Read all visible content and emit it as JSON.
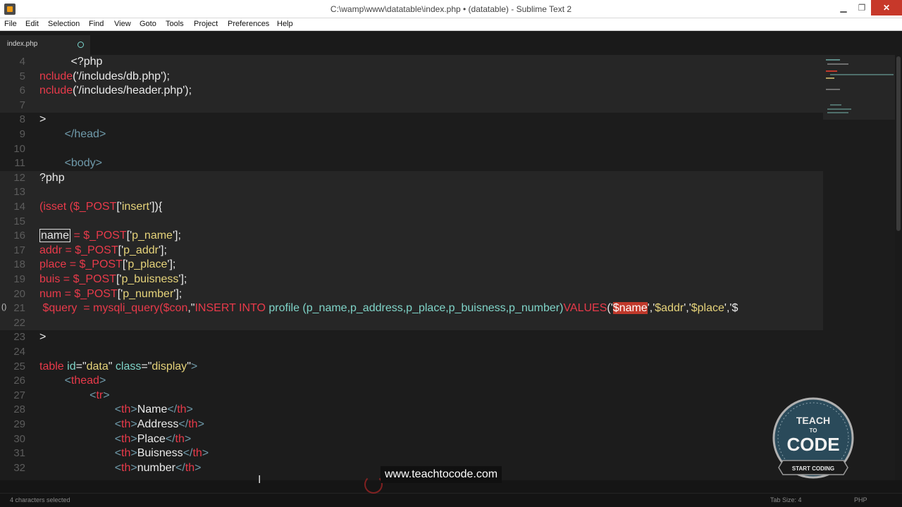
{
  "window": {
    "title": "C:\\wamp\\www\\datatable\\index.php • (datatable) - Sublime Text 2",
    "minimize": "▁",
    "maximize": "❐",
    "close": "✕"
  },
  "menu": [
    "File",
    "Edit",
    "Selection",
    "Find",
    "View",
    "Goto",
    "Tools",
    "Project",
    "Preferences",
    "Help"
  ],
  "tab": {
    "label": "index.php"
  },
  "editor": {
    "lines": [
      {
        "n": "4",
        "hl": true,
        "tokens": [
          [
            "plain",
            "          <?php"
          ]
        ]
      },
      {
        "n": "5",
        "hl": true,
        "tokens": [
          [
            "kw",
            "nclude"
          ],
          [
            "plain",
            "('/includes/db.php');"
          ]
        ]
      },
      {
        "n": "6",
        "hl": true,
        "tokens": [
          [
            "kw",
            "nclude"
          ],
          [
            "plain",
            "('/includes/header.php');"
          ]
        ]
      },
      {
        "n": "7",
        "hl": true,
        "tokens": [
          [
            "plain",
            ""
          ]
        ]
      },
      {
        "n": "8",
        "hl": false,
        "tokens": [
          [
            "plain",
            ">"
          ]
        ]
      },
      {
        "n": "9",
        "hl": false,
        "tokens": [
          [
            "tag",
            "        </"
          ],
          [
            "tag",
            "head"
          ],
          [
            "tag",
            ">"
          ]
        ]
      },
      {
        "n": "10",
        "hl": false,
        "tokens": [
          [
            "plain",
            ""
          ]
        ]
      },
      {
        "n": "11",
        "hl": false,
        "tokens": [
          [
            "tag",
            "        <"
          ],
          [
            "tag",
            "body"
          ],
          [
            "tag",
            ">"
          ]
        ]
      },
      {
        "n": "12",
        "hl": true,
        "tokens": [
          [
            "plain",
            "?php"
          ]
        ]
      },
      {
        "n": "13",
        "hl": true,
        "tokens": [
          [
            "plain",
            ""
          ]
        ]
      },
      {
        "n": "14",
        "hl": true,
        "tokens": [
          [
            "kw",
            "(isset ($_POST"
          ],
          [
            "plain",
            "['"
          ],
          [
            "str",
            "insert"
          ],
          [
            "plain",
            "']){"
          ]
        ]
      },
      {
        "n": "15",
        "hl": true,
        "tokens": [
          [
            "plain",
            ""
          ]
        ]
      },
      {
        "n": "16",
        "hl": true,
        "tokens": [
          [
            "box",
            "name"
          ],
          [
            "kw",
            " = $_POST"
          ],
          [
            "plain",
            "['"
          ],
          [
            "str",
            "p_name"
          ],
          [
            "plain",
            "'];"
          ]
        ]
      },
      {
        "n": "17",
        "hl": true,
        "tokens": [
          [
            "kw",
            "addr = $_POST"
          ],
          [
            "plain",
            "['"
          ],
          [
            "str",
            "p_addr"
          ],
          [
            "plain",
            "'];"
          ]
        ]
      },
      {
        "n": "18",
        "hl": true,
        "tokens": [
          [
            "kw",
            "place = $_POST"
          ],
          [
            "plain",
            "['"
          ],
          [
            "str",
            "p_place"
          ],
          [
            "plain",
            "'];"
          ]
        ]
      },
      {
        "n": "19",
        "hl": true,
        "tokens": [
          [
            "kw",
            "buis = $_POST"
          ],
          [
            "plain",
            "['"
          ],
          [
            "str",
            "p_buisness"
          ],
          [
            "plain",
            "'];"
          ]
        ]
      },
      {
        "n": "20",
        "hl": true,
        "tokens": [
          [
            "kw",
            "num = $_POST"
          ],
          [
            "plain",
            "['"
          ],
          [
            "str",
            "p_number"
          ],
          [
            "plain",
            "'];"
          ]
        ]
      },
      {
        "n": "21",
        "hl": true,
        "tokens": [
          [
            "kw",
            " $query  = mysqli_query("
          ],
          [
            "kw",
            "$con"
          ],
          [
            "plain",
            ",\""
          ],
          [
            "kw",
            "INSERT INTO "
          ],
          [
            "fn",
            "profile (p_name,p_address,p_place,p_buisness,p_number)"
          ],
          [
            "kw",
            "VALUES"
          ],
          [
            "plain",
            "('"
          ],
          [
            "sel",
            "$name"
          ],
          [
            "plain",
            "','"
          ],
          [
            "str",
            "$addr"
          ],
          [
            "plain",
            "','"
          ],
          [
            "str",
            "$place"
          ],
          [
            "plain",
            "','$"
          ]
        ]
      },
      {
        "n": "22",
        "hl": true,
        "tokens": [
          [
            "plain",
            ""
          ]
        ]
      },
      {
        "n": "23",
        "hl": false,
        "tokens": [
          [
            "plain",
            ">"
          ]
        ]
      },
      {
        "n": "24",
        "hl": false,
        "tokens": [
          [
            "plain",
            ""
          ]
        ]
      },
      {
        "n": "25",
        "hl": false,
        "tokens": [
          [
            "kw",
            "table "
          ],
          [
            "att",
            "id"
          ],
          [
            "plain",
            "=\""
          ],
          [
            "str",
            "data"
          ],
          [
            "plain",
            "\" "
          ],
          [
            "att",
            "class"
          ],
          [
            "plain",
            "=\""
          ],
          [
            "str",
            "display"
          ],
          [
            "plain",
            "\""
          ],
          [
            "tag",
            ">"
          ]
        ]
      },
      {
        "n": "26",
        "hl": false,
        "tokens": [
          [
            "tag",
            "        <"
          ],
          [
            "kw",
            "thead"
          ],
          [
            "tag",
            ">"
          ]
        ]
      },
      {
        "n": "27",
        "hl": false,
        "tokens": [
          [
            "tag",
            "                <"
          ],
          [
            "kw",
            "tr"
          ],
          [
            "tag",
            ">"
          ]
        ]
      },
      {
        "n": "28",
        "hl": false,
        "tokens": [
          [
            "tag",
            "                        <"
          ],
          [
            "kw",
            "th"
          ],
          [
            "tag",
            ">"
          ],
          [
            "plain",
            "Name"
          ],
          [
            "tag",
            "</"
          ],
          [
            "kw",
            "th"
          ],
          [
            "tag",
            ">"
          ]
        ]
      },
      {
        "n": "29",
        "hl": false,
        "tokens": [
          [
            "tag",
            "                        <"
          ],
          [
            "kw",
            "th"
          ],
          [
            "tag",
            ">"
          ],
          [
            "plain",
            "Address"
          ],
          [
            "tag",
            "</"
          ],
          [
            "kw",
            "th"
          ],
          [
            "tag",
            ">"
          ]
        ]
      },
      {
        "n": "30",
        "hl": false,
        "tokens": [
          [
            "tag",
            "                        <"
          ],
          [
            "kw",
            "th"
          ],
          [
            "tag",
            ">"
          ],
          [
            "plain",
            "Place"
          ],
          [
            "tag",
            "</"
          ],
          [
            "kw",
            "th"
          ],
          [
            "tag",
            ">"
          ]
        ]
      },
      {
        "n": "31",
        "hl": false,
        "tokens": [
          [
            "tag",
            "                        <"
          ],
          [
            "kw",
            "th"
          ],
          [
            "tag",
            ">"
          ],
          [
            "plain",
            "Buisness"
          ],
          [
            "tag",
            "</"
          ],
          [
            "kw",
            "th"
          ],
          [
            "tag",
            ">"
          ]
        ]
      },
      {
        "n": "32",
        "hl": false,
        "tokens": [
          [
            "tag",
            "                        <"
          ],
          [
            "kw",
            "th"
          ],
          [
            "tag",
            ">"
          ],
          [
            "plain",
            "number"
          ],
          [
            "tag",
            "</"
          ],
          [
            "kw",
            "th"
          ],
          [
            "tag",
            ">"
          ]
        ]
      }
    ]
  },
  "status": {
    "selection": "4 characters selected",
    "tab_size": "Tab Size: 4",
    "syntax": "PHP"
  },
  "watermark": "www.teachtocode.com",
  "logo": {
    "top": "TEACH",
    "mid": "TO",
    "main": "CODE",
    "ribbon": "START CODING"
  },
  "colors": {
    "background": "#1c1c1c",
    "keyword": "#e83a4a",
    "string": "#e6d37a",
    "function": "#7fd4c8",
    "selection": "#c0392b"
  }
}
